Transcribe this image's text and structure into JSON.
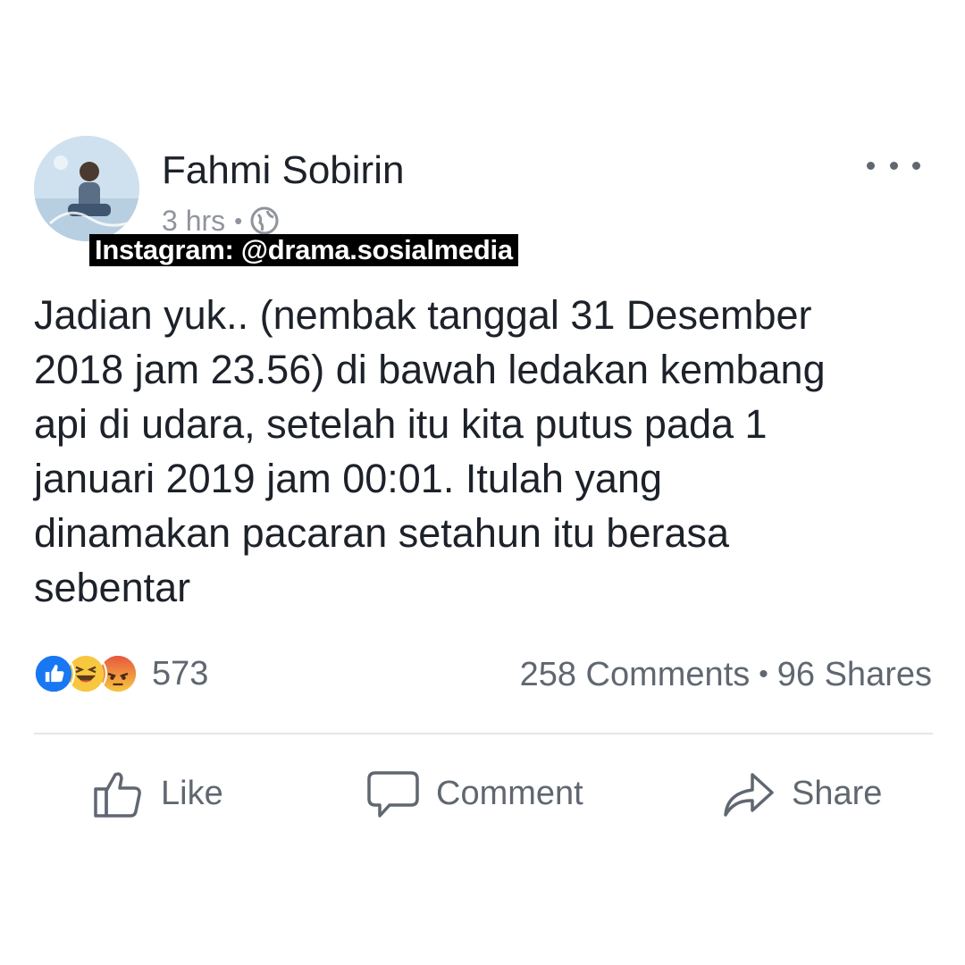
{
  "post": {
    "author_name": "Fahmi Sobirin",
    "timestamp": "3 hrs",
    "meta_separator": "•",
    "privacy_icon": "globe-icon",
    "text": "Jadian yuk.. (nembak tanggal 31 Desember\n2018 jam 23.56) di bawah ledakan kembang\napi di udara, setelah itu kita putus pada 1\njanuari 2019 jam 00:01. Itulah yang\ndinamakan pacaran setahun itu berasa\nsebentar"
  },
  "watermark": {
    "text": "Instagram: @drama.sosialmedia"
  },
  "reactions": {
    "icons": [
      "like-icon",
      "haha-icon",
      "angry-icon"
    ],
    "count": "573"
  },
  "stats": {
    "comments": "258 Comments",
    "separator": "•",
    "shares": "96 Shares"
  },
  "actions": {
    "like_label": "Like",
    "comment_label": "Comment",
    "share_label": "Share"
  },
  "colors": {
    "text_primary": "#1d2129",
    "text_secondary": "#606770",
    "like_blue": "#1877f2",
    "haha_yellow": "#f7c740",
    "angry_red": "#e9573e",
    "divider": "#e5e6ea"
  }
}
